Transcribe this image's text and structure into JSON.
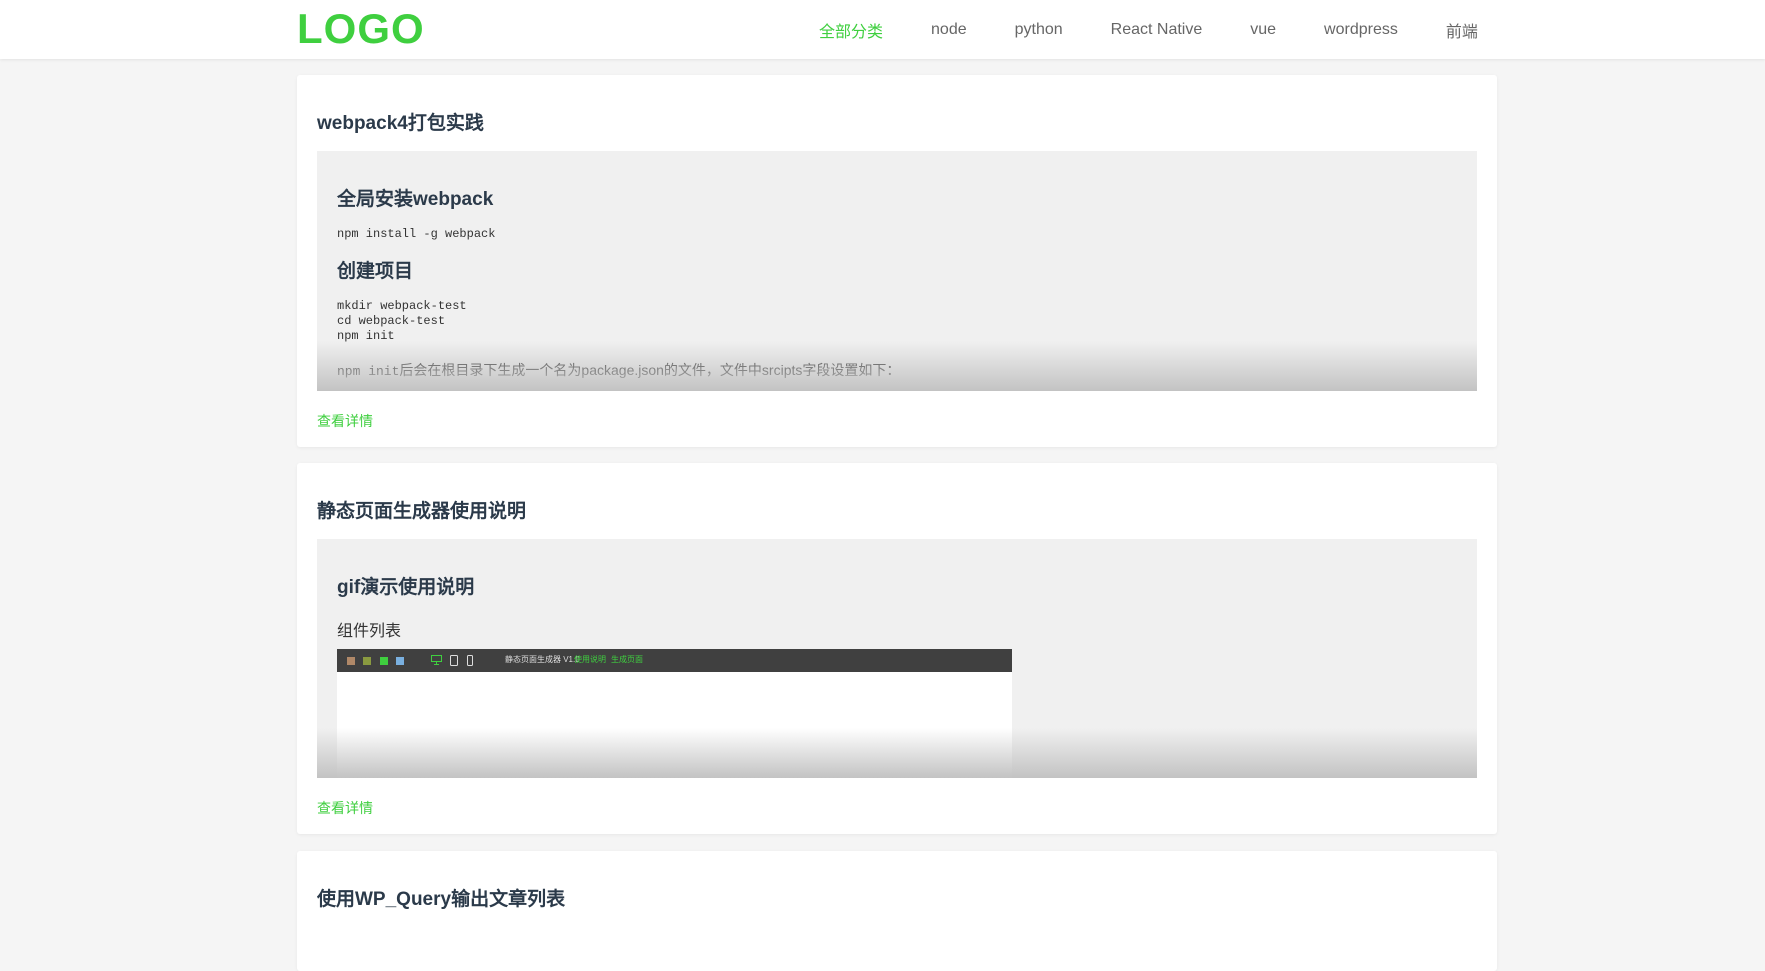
{
  "header": {
    "logo": "LOGO",
    "nav": [
      {
        "label": "全部分类",
        "active": true
      },
      {
        "label": "node",
        "active": false
      },
      {
        "label": "python",
        "active": false
      },
      {
        "label": "React Native",
        "active": false
      },
      {
        "label": "vue",
        "active": false
      },
      {
        "label": "wordpress",
        "active": false
      },
      {
        "label": "前端",
        "active": false
      }
    ]
  },
  "colors": {
    "accent": "#3fcf3f",
    "title": "#2b3a4a",
    "excerpt_bg": "#f0f0f0",
    "page_bg": "#f5f5f5"
  },
  "posts": [
    {
      "title": "webpack4打包实践",
      "excerpt": {
        "h1": "全局安装webpack",
        "code1": "npm install -g webpack",
        "h2": "创建项目",
        "code2": "mkdir webpack-test\ncd webpack-test\nnpm init",
        "p_code": "npm init",
        "p_text": "后会在根目录下生成一个名为package.json的文件，文件中srcipts字段设置如下："
      },
      "more": "查看详情"
    },
    {
      "title": "静态页面生成器使用说明",
      "excerpt": {
        "h1": "gif演示使用说明",
        "p": "组件列表",
        "shot": {
          "title": "静态页面生成器 V1.0",
          "link1": "使用说明",
          "link2": "生成页面",
          "icons": [
            "monitor-icon",
            "tablet-icon",
            "phone-icon"
          ],
          "swatches": [
            "#b08868",
            "#8a9a40",
            "#3fcf3f",
            "#7ab0e0"
          ]
        }
      },
      "more": "查看详情"
    },
    {
      "title": "使用WP_Query输出文章列表"
    }
  ]
}
